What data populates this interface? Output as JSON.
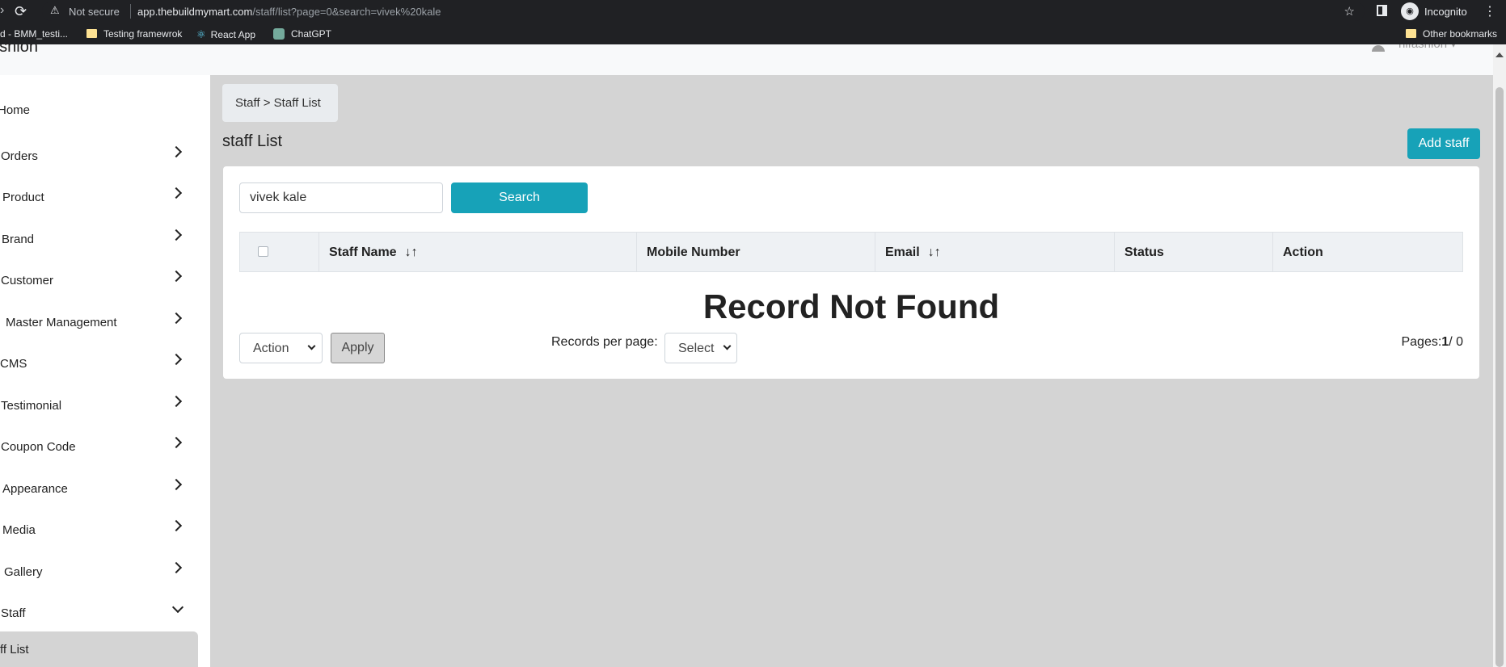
{
  "browser": {
    "security": "Not secure",
    "url_host": "app.thebuildmymart.com",
    "url_path": "/staff/list?page=0&search=vivek%20kale",
    "profile": "Incognito",
    "bookmarks": [
      {
        "label": "rd - BMM_testi...",
        "icon": "favicon"
      },
      {
        "label": "Testing framewrok",
        "icon": "folder-icon"
      },
      {
        "label": "React App",
        "icon": "react-icon"
      },
      {
        "label": "ChatGPT",
        "icon": "chatgpt-icon"
      }
    ],
    "other_bookmarks": "Other bookmarks"
  },
  "app": {
    "brand": "ashion",
    "user_name": "hifashion",
    "sidebar": [
      {
        "label": "Home",
        "chevron": "none"
      },
      {
        "label": "Orders",
        "chevron": "right"
      },
      {
        "label": "Product",
        "chevron": "right"
      },
      {
        "label": "Brand",
        "chevron": "right"
      },
      {
        "label": "Customer",
        "chevron": "right"
      },
      {
        "label": "Master Management",
        "chevron": "right"
      },
      {
        "label": "CMS",
        "chevron": "right"
      },
      {
        "label": "Testimonial",
        "chevron": "right"
      },
      {
        "label": "Coupon Code",
        "chevron": "right"
      },
      {
        "label": "Appearance",
        "chevron": "right"
      },
      {
        "label": "Media",
        "chevron": "right"
      },
      {
        "label": "Gallery",
        "chevron": "right"
      },
      {
        "label": "Staff",
        "chevron": "down"
      }
    ],
    "sidebar_active_sub": "ff List"
  },
  "page": {
    "breadcrumb": "Staff > Staff List",
    "title": "staff List",
    "add_button": "Add staff",
    "search_value": "vivek kale",
    "search_button": "Search",
    "columns": [
      "Staff Name",
      "Mobile Number",
      "Email",
      "Status",
      "Action"
    ],
    "empty_message": "Record Not Found",
    "bulk_action": "Action",
    "apply_button": "Apply",
    "records_per_page_label": "Records per page:",
    "records_per_page_value": "Select",
    "pages_label": "Pages:",
    "pages_current": "1",
    "pages_total": "/ 0"
  },
  "colors": {
    "accent": "#17a2b8",
    "content_bg": "#d4d4d4",
    "chrome_bg": "#202124"
  }
}
